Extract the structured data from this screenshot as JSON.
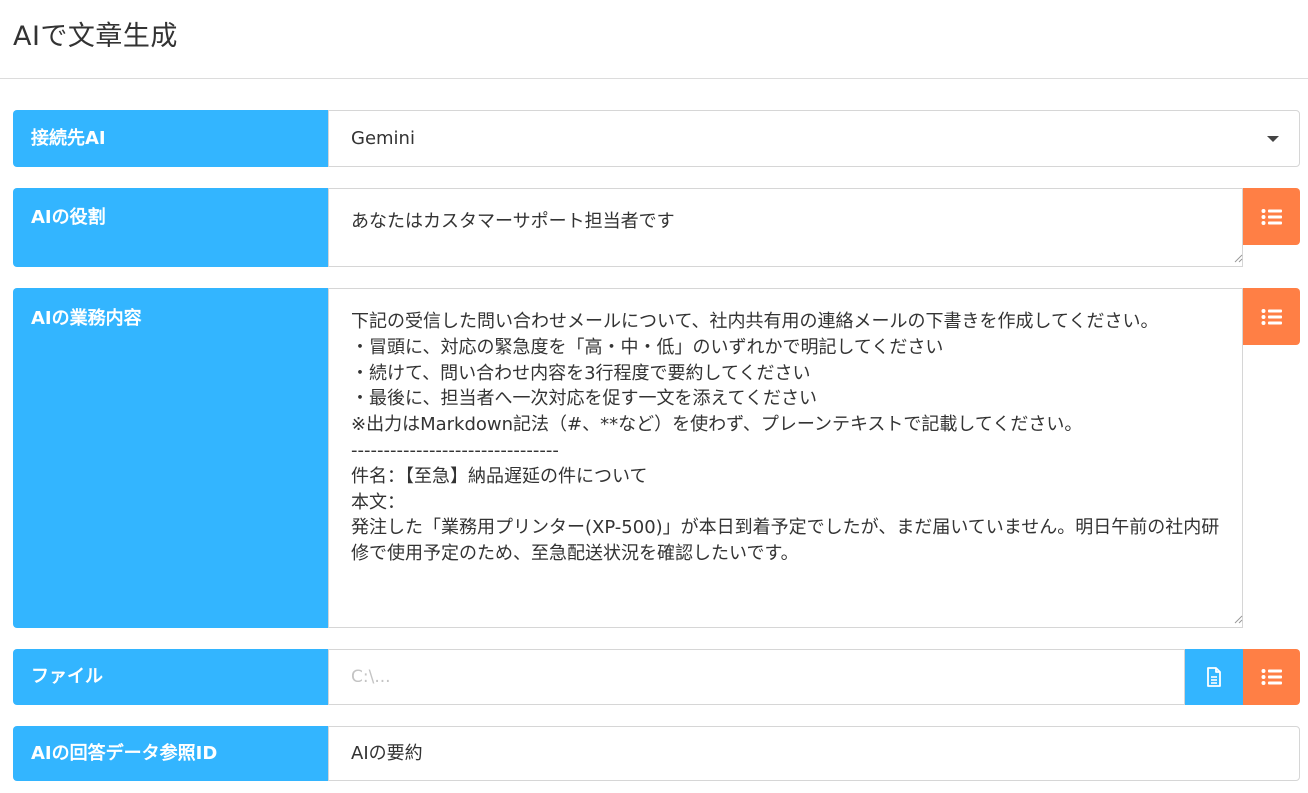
{
  "page": {
    "title": "AIで文章生成"
  },
  "colors": {
    "label_bg": "#33b5ff",
    "action_button": "#ff7f45",
    "file_button": "#33b5ff"
  },
  "form": {
    "ai_target": {
      "label": "接続先AI",
      "selected": "Gemini"
    },
    "ai_role": {
      "label": "AIの役割",
      "value": "あなたはカスタマーサポート担当者です"
    },
    "ai_task": {
      "label": "AIの業務内容",
      "value": "下記の受信した問い合わせメールについて、社内共有用の連絡メールの下書きを作成してください。\n・冒頭に、対応の緊急度を「高・中・低」のいずれかで明記してください\n・続けて、問い合わせ内容を3行程度で要約してください\n・最後に、担当者へ一次対応を促す一文を添えてください\n※出力はMarkdown記法（#、**など）を使わず、プレーンテキストで記載してください。\n--------------------------------\n件名：【至急】納品遅延の件について\n本文：\n発注した「業務用プリンター(XP-500)」が本日到着予定でしたが、まだ届いていません。明日午前の社内研修で使用予定のため、至急配送状況を確認したいです。"
    },
    "file": {
      "label": "ファイル",
      "placeholder": "C:\\..."
    },
    "reference_id": {
      "label": "AIの回答データ参照ID",
      "value": "AIの要約"
    }
  },
  "icons": {
    "list": "list-icon",
    "file": "file-icon",
    "dropdown": "caret-down-icon"
  }
}
